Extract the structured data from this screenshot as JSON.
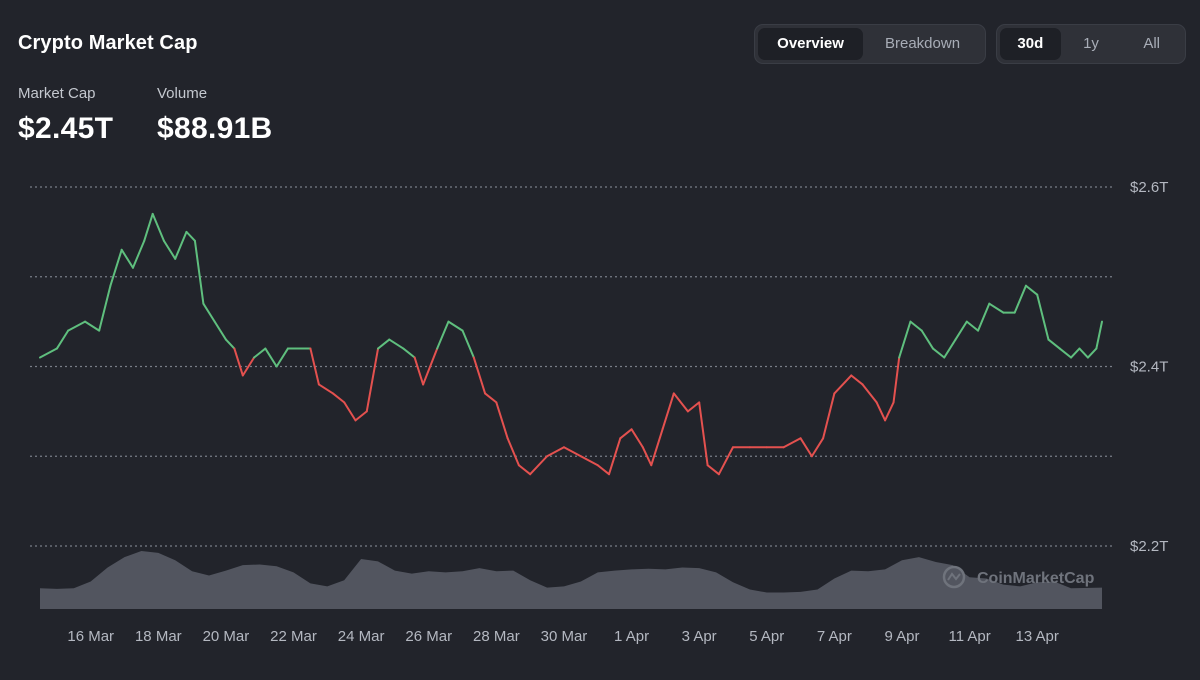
{
  "header": {
    "title": "Crypto Market Cap",
    "view_tabs": [
      {
        "label": "Overview",
        "active": true
      },
      {
        "label": "Breakdown",
        "active": false
      }
    ],
    "range_tabs": [
      {
        "label": "30d",
        "active": true
      },
      {
        "label": "1y",
        "active": false
      },
      {
        "label": "All",
        "active": false
      }
    ]
  },
  "stats": {
    "market_cap": {
      "label": "Market Cap",
      "value": "$2.45T"
    },
    "volume": {
      "label": "Volume",
      "value": "$88.91B"
    }
  },
  "watermark": "CoinMarketCap",
  "colors": {
    "up": "#5fbf7e",
    "down": "#e4514f",
    "volume_fill": "#5a5e68",
    "gridline": "#7a7e88",
    "background": "#22242b"
  },
  "chart_data": {
    "type": "line",
    "series": [
      {
        "name": "Market Cap",
        "unit": "T USD",
        "baseline": 2.41,
        "points": [
          [
            "2025-03-14 12:00",
            2.41
          ],
          [
            "2025-03-15 00:00",
            2.42
          ],
          [
            "2025-03-15 08:00",
            2.44
          ],
          [
            "2025-03-15 20:00",
            2.45
          ],
          [
            "2025-03-16 06:00",
            2.44
          ],
          [
            "2025-03-16 14:00",
            2.49
          ],
          [
            "2025-03-16 22:00",
            2.53
          ],
          [
            "2025-03-17 06:00",
            2.51
          ],
          [
            "2025-03-17 14:00",
            2.54
          ],
          [
            "2025-03-17 20:00",
            2.57
          ],
          [
            "2025-03-18 04:00",
            2.54
          ],
          [
            "2025-03-18 12:00",
            2.52
          ],
          [
            "2025-03-18 20:00",
            2.55
          ],
          [
            "2025-03-19 02:00",
            2.54
          ],
          [
            "2025-03-19 08:00",
            2.47
          ],
          [
            "2025-03-19 16:00",
            2.45
          ],
          [
            "2025-03-20 00:00",
            2.43
          ],
          [
            "2025-03-20 06:00",
            2.42
          ],
          [
            "2025-03-20 12:00",
            2.39
          ],
          [
            "2025-03-20 20:00",
            2.41
          ],
          [
            "2025-03-21 04:00",
            2.42
          ],
          [
            "2025-03-21 12:00",
            2.4
          ],
          [
            "2025-03-21 20:00",
            2.42
          ],
          [
            "2025-03-22 06:00",
            2.42
          ],
          [
            "2025-03-22 12:00",
            2.42
          ],
          [
            "2025-03-22 18:00",
            2.38
          ],
          [
            "2025-03-23 04:00",
            2.37
          ],
          [
            "2025-03-23 12:00",
            2.36
          ],
          [
            "2025-03-23 20:00",
            2.34
          ],
          [
            "2025-03-24 04:00",
            2.35
          ],
          [
            "2025-03-24 12:00",
            2.42
          ],
          [
            "2025-03-24 20:00",
            2.43
          ],
          [
            "2025-03-25 06:00",
            2.42
          ],
          [
            "2025-03-25 14:00",
            2.41
          ],
          [
            "2025-03-25 20:00",
            2.38
          ],
          [
            "2025-03-26 06:00",
            2.42
          ],
          [
            "2025-03-26 14:00",
            2.45
          ],
          [
            "2025-03-27 00:00",
            2.44
          ],
          [
            "2025-03-27 08:00",
            2.41
          ],
          [
            "2025-03-27 16:00",
            2.37
          ],
          [
            "2025-03-28 00:00",
            2.36
          ],
          [
            "2025-03-28 08:00",
            2.32
          ],
          [
            "2025-03-28 16:00",
            2.29
          ],
          [
            "2025-03-29 00:00",
            2.28
          ],
          [
            "2025-03-29 12:00",
            2.3
          ],
          [
            "2025-03-30 00:00",
            2.31
          ],
          [
            "2025-03-30 12:00",
            2.3
          ],
          [
            "2025-03-31 00:00",
            2.29
          ],
          [
            "2025-03-31 08:00",
            2.28
          ],
          [
            "2025-03-31 16:00",
            2.32
          ],
          [
            "2025-04-01 00:00",
            2.33
          ],
          [
            "2025-04-01 08:00",
            2.31
          ],
          [
            "2025-04-01 14:00",
            2.29
          ],
          [
            "2025-04-01 22:00",
            2.33
          ],
          [
            "2025-04-02 06:00",
            2.37
          ],
          [
            "2025-04-02 16:00",
            2.35
          ],
          [
            "2025-04-03 00:00",
            2.36
          ],
          [
            "2025-04-03 06:00",
            2.29
          ],
          [
            "2025-04-03 14:00",
            2.28
          ],
          [
            "2025-04-04 00:00",
            2.31
          ],
          [
            "2025-04-04 12:00",
            2.31
          ],
          [
            "2025-04-05 00:00",
            2.31
          ],
          [
            "2025-04-05 12:00",
            2.31
          ],
          [
            "2025-04-06 00:00",
            2.32
          ],
          [
            "2025-04-06 08:00",
            2.3
          ],
          [
            "2025-04-06 16:00",
            2.32
          ],
          [
            "2025-04-07 00:00",
            2.37
          ],
          [
            "2025-04-07 12:00",
            2.39
          ],
          [
            "2025-04-07 20:00",
            2.38
          ],
          [
            "2025-04-08 06:00",
            2.36
          ],
          [
            "2025-04-08 12:00",
            2.34
          ],
          [
            "2025-04-08 18:00",
            2.36
          ],
          [
            "2025-04-08 22:00",
            2.41
          ],
          [
            "2025-04-09 06:00",
            2.45
          ],
          [
            "2025-04-09 14:00",
            2.44
          ],
          [
            "2025-04-09 22:00",
            2.42
          ],
          [
            "2025-04-10 06:00",
            2.41
          ],
          [
            "2025-04-10 14:00",
            2.43
          ],
          [
            "2025-04-10 22:00",
            2.45
          ],
          [
            "2025-04-11 06:00",
            2.44
          ],
          [
            "2025-04-11 14:00",
            2.47
          ],
          [
            "2025-04-12 00:00",
            2.46
          ],
          [
            "2025-04-12 08:00",
            2.46
          ],
          [
            "2025-04-12 16:00",
            2.49
          ],
          [
            "2025-04-13 00:00",
            2.48
          ],
          [
            "2025-04-13 08:00",
            2.43
          ],
          [
            "2025-04-13 16:00",
            2.42
          ],
          [
            "2025-04-14 00:00",
            2.41
          ],
          [
            "2025-04-14 06:00",
            2.42
          ],
          [
            "2025-04-14 12:00",
            2.41
          ],
          [
            "2025-04-14 18:00",
            2.42
          ],
          [
            "2025-04-14 22:00",
            2.45
          ]
        ]
      },
      {
        "name": "Volume",
        "relative": true,
        "points": [
          [
            "2025-03-14 12:00",
            0.34
          ],
          [
            "2025-03-15 00:00",
            0.33
          ],
          [
            "2025-03-15 12:00",
            0.34
          ],
          [
            "2025-03-16 00:00",
            0.45
          ],
          [
            "2025-03-16 12:00",
            0.68
          ],
          [
            "2025-03-17 00:00",
            0.85
          ],
          [
            "2025-03-17 12:00",
            0.95
          ],
          [
            "2025-03-18 00:00",
            0.92
          ],
          [
            "2025-03-18 12:00",
            0.8
          ],
          [
            "2025-03-19 00:00",
            0.62
          ],
          [
            "2025-03-19 12:00",
            0.55
          ],
          [
            "2025-03-20 00:00",
            0.63
          ],
          [
            "2025-03-20 12:00",
            0.72
          ],
          [
            "2025-03-21 00:00",
            0.73
          ],
          [
            "2025-03-21 12:00",
            0.7
          ],
          [
            "2025-03-22 00:00",
            0.6
          ],
          [
            "2025-03-22 12:00",
            0.42
          ],
          [
            "2025-03-23 00:00",
            0.37
          ],
          [
            "2025-03-23 12:00",
            0.47
          ],
          [
            "2025-03-24 00:00",
            0.82
          ],
          [
            "2025-03-24 12:00",
            0.78
          ],
          [
            "2025-03-25 00:00",
            0.63
          ],
          [
            "2025-03-25 12:00",
            0.58
          ],
          [
            "2025-03-26 00:00",
            0.62
          ],
          [
            "2025-03-26 12:00",
            0.6
          ],
          [
            "2025-03-27 00:00",
            0.62
          ],
          [
            "2025-03-27 12:00",
            0.67
          ],
          [
            "2025-03-28 00:00",
            0.62
          ],
          [
            "2025-03-28 12:00",
            0.63
          ],
          [
            "2025-03-29 00:00",
            0.47
          ],
          [
            "2025-03-29 12:00",
            0.35
          ],
          [
            "2025-03-30 00:00",
            0.37
          ],
          [
            "2025-03-30 12:00",
            0.45
          ],
          [
            "2025-03-31 00:00",
            0.6
          ],
          [
            "2025-03-31 12:00",
            0.63
          ],
          [
            "2025-04-01 00:00",
            0.65
          ],
          [
            "2025-04-01 12:00",
            0.66
          ],
          [
            "2025-04-02 00:00",
            0.65
          ],
          [
            "2025-04-02 12:00",
            0.68
          ],
          [
            "2025-04-03 00:00",
            0.67
          ],
          [
            "2025-04-03 12:00",
            0.6
          ],
          [
            "2025-04-04 00:00",
            0.44
          ],
          [
            "2025-04-04 12:00",
            0.32
          ],
          [
            "2025-04-05 00:00",
            0.27
          ],
          [
            "2025-04-05 12:00",
            0.27
          ],
          [
            "2025-04-06 00:00",
            0.28
          ],
          [
            "2025-04-06 12:00",
            0.32
          ],
          [
            "2025-04-07 00:00",
            0.5
          ],
          [
            "2025-04-07 12:00",
            0.63
          ],
          [
            "2025-04-08 00:00",
            0.62
          ],
          [
            "2025-04-08 12:00",
            0.65
          ],
          [
            "2025-04-09 00:00",
            0.8
          ],
          [
            "2025-04-09 12:00",
            0.85
          ],
          [
            "2025-04-10 00:00",
            0.77
          ],
          [
            "2025-04-10 12:00",
            0.72
          ],
          [
            "2025-04-11 00:00",
            0.52
          ],
          [
            "2025-04-11 12:00",
            0.5
          ],
          [
            "2025-04-12 00:00",
            0.4
          ],
          [
            "2025-04-12 12:00",
            0.37
          ],
          [
            "2025-04-13 00:00",
            0.44
          ],
          [
            "2025-04-13 12:00",
            0.45
          ],
          [
            "2025-04-14 00:00",
            0.34
          ],
          [
            "2025-04-14 22:00",
            0.35
          ]
        ]
      }
    ],
    "x_range": [
      "2025-03-14 12:00",
      "2025-04-14 22:00"
    ],
    "x_ticks": [
      [
        "2025-03-16",
        "16 Mar"
      ],
      [
        "2025-03-18",
        "18 Mar"
      ],
      [
        "2025-03-20",
        "20 Mar"
      ],
      [
        "2025-03-22",
        "22 Mar"
      ],
      [
        "2025-03-24",
        "24 Mar"
      ],
      [
        "2025-03-26",
        "26 Mar"
      ],
      [
        "2025-03-28",
        "28 Mar"
      ],
      [
        "2025-03-30",
        "30 Mar"
      ],
      [
        "2025-04-01",
        "1 Apr"
      ],
      [
        "2025-04-03",
        "3 Apr"
      ],
      [
        "2025-04-05",
        "5 Apr"
      ],
      [
        "2025-04-07",
        "7 Apr"
      ],
      [
        "2025-04-09",
        "9 Apr"
      ],
      [
        "2025-04-11",
        "11 Apr"
      ],
      [
        "2025-04-13",
        "13 Apr"
      ]
    ],
    "y_range": [
      2.2,
      2.6
    ],
    "y_gridlines": [
      2.2,
      2.3,
      2.4,
      2.5,
      2.6
    ],
    "y_ticks": [
      [
        2.6,
        "$2.6T"
      ],
      [
        2.4,
        "$2.4T"
      ],
      [
        2.2,
        "$2.2T"
      ]
    ],
    "grid": "dotted horizontal"
  }
}
